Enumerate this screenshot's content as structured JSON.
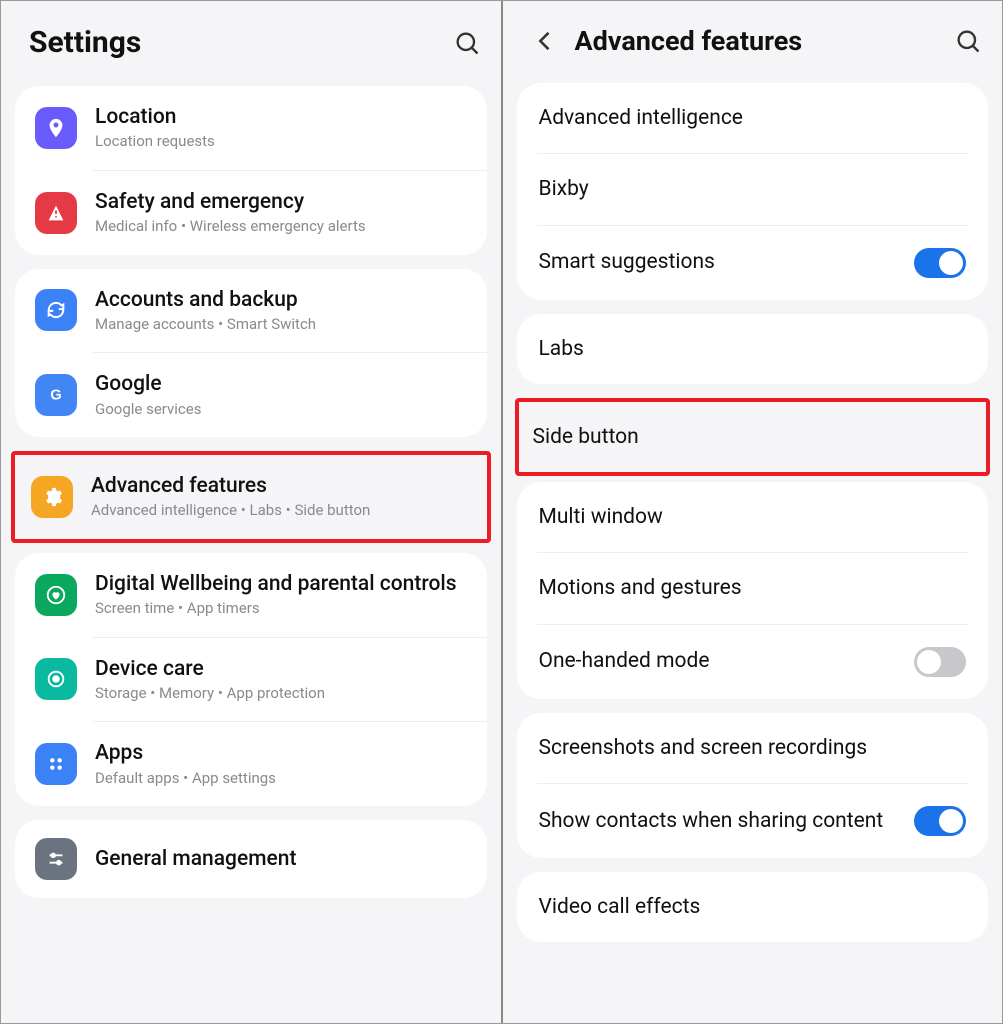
{
  "left": {
    "title": "Settings",
    "groups": [
      {
        "items": [
          {
            "title": "Location",
            "sub": "Location requests",
            "iconBg": "bg-purple",
            "iconName": "location-icon"
          },
          {
            "title": "Safety and emergency",
            "sub": "Medical info  •  Wireless emergency alerts",
            "iconBg": "bg-red",
            "iconName": "safety-icon"
          }
        ]
      },
      {
        "items": [
          {
            "title": "Accounts and backup",
            "sub": "Manage accounts  •  Smart Switch",
            "iconBg": "bg-blue",
            "iconName": "sync-icon"
          },
          {
            "title": "Google",
            "sub": "Google services",
            "iconBg": "bg-google",
            "iconName": "google-icon"
          }
        ]
      }
    ],
    "highlighted": {
      "title": "Advanced features",
      "sub": "Advanced intelligence  •  Labs  •  Side button",
      "iconBg": "bg-yellow",
      "iconName": "gear-icon"
    },
    "groups2": [
      {
        "items": [
          {
            "title": "Digital Wellbeing and parental controls",
            "sub": "Screen time  •  App timers",
            "iconBg": "bg-green",
            "iconName": "heart-circle-icon"
          },
          {
            "title": "Device care",
            "sub": "Storage  •  Memory  •  App protection",
            "iconBg": "bg-teal",
            "iconName": "device-care-icon"
          },
          {
            "title": "Apps",
            "sub": "Default apps  •  App settings",
            "iconBg": "bg-blue2",
            "iconName": "apps-icon"
          }
        ]
      },
      {
        "items": [
          {
            "title": "General management",
            "sub": "",
            "iconBg": "bg-gray",
            "iconName": "sliders-icon"
          }
        ]
      }
    ]
  },
  "right": {
    "title": "Advanced features",
    "groups": [
      {
        "items": [
          {
            "title": "Advanced intelligence",
            "toggle": null
          },
          {
            "title": "Bixby",
            "toggle": null
          },
          {
            "title": "Smart suggestions",
            "toggle": "on"
          }
        ]
      },
      {
        "items": [
          {
            "title": "Labs",
            "toggle": null
          }
        ]
      },
      {
        "highlight": true,
        "items": [
          {
            "title": "Side button",
            "toggle": null
          }
        ]
      },
      {
        "items": [
          {
            "title": "Multi window",
            "toggle": null
          },
          {
            "title": "Motions and gestures",
            "toggle": null
          },
          {
            "title": "One-handed mode",
            "toggle": "off"
          }
        ]
      },
      {
        "items": [
          {
            "title": "Screenshots and screen recordings",
            "toggle": null
          },
          {
            "title": "Show contacts when sharing content",
            "toggle": "on"
          }
        ]
      },
      {
        "items": [
          {
            "title": "Video call effects",
            "toggle": null
          }
        ]
      }
    ]
  }
}
